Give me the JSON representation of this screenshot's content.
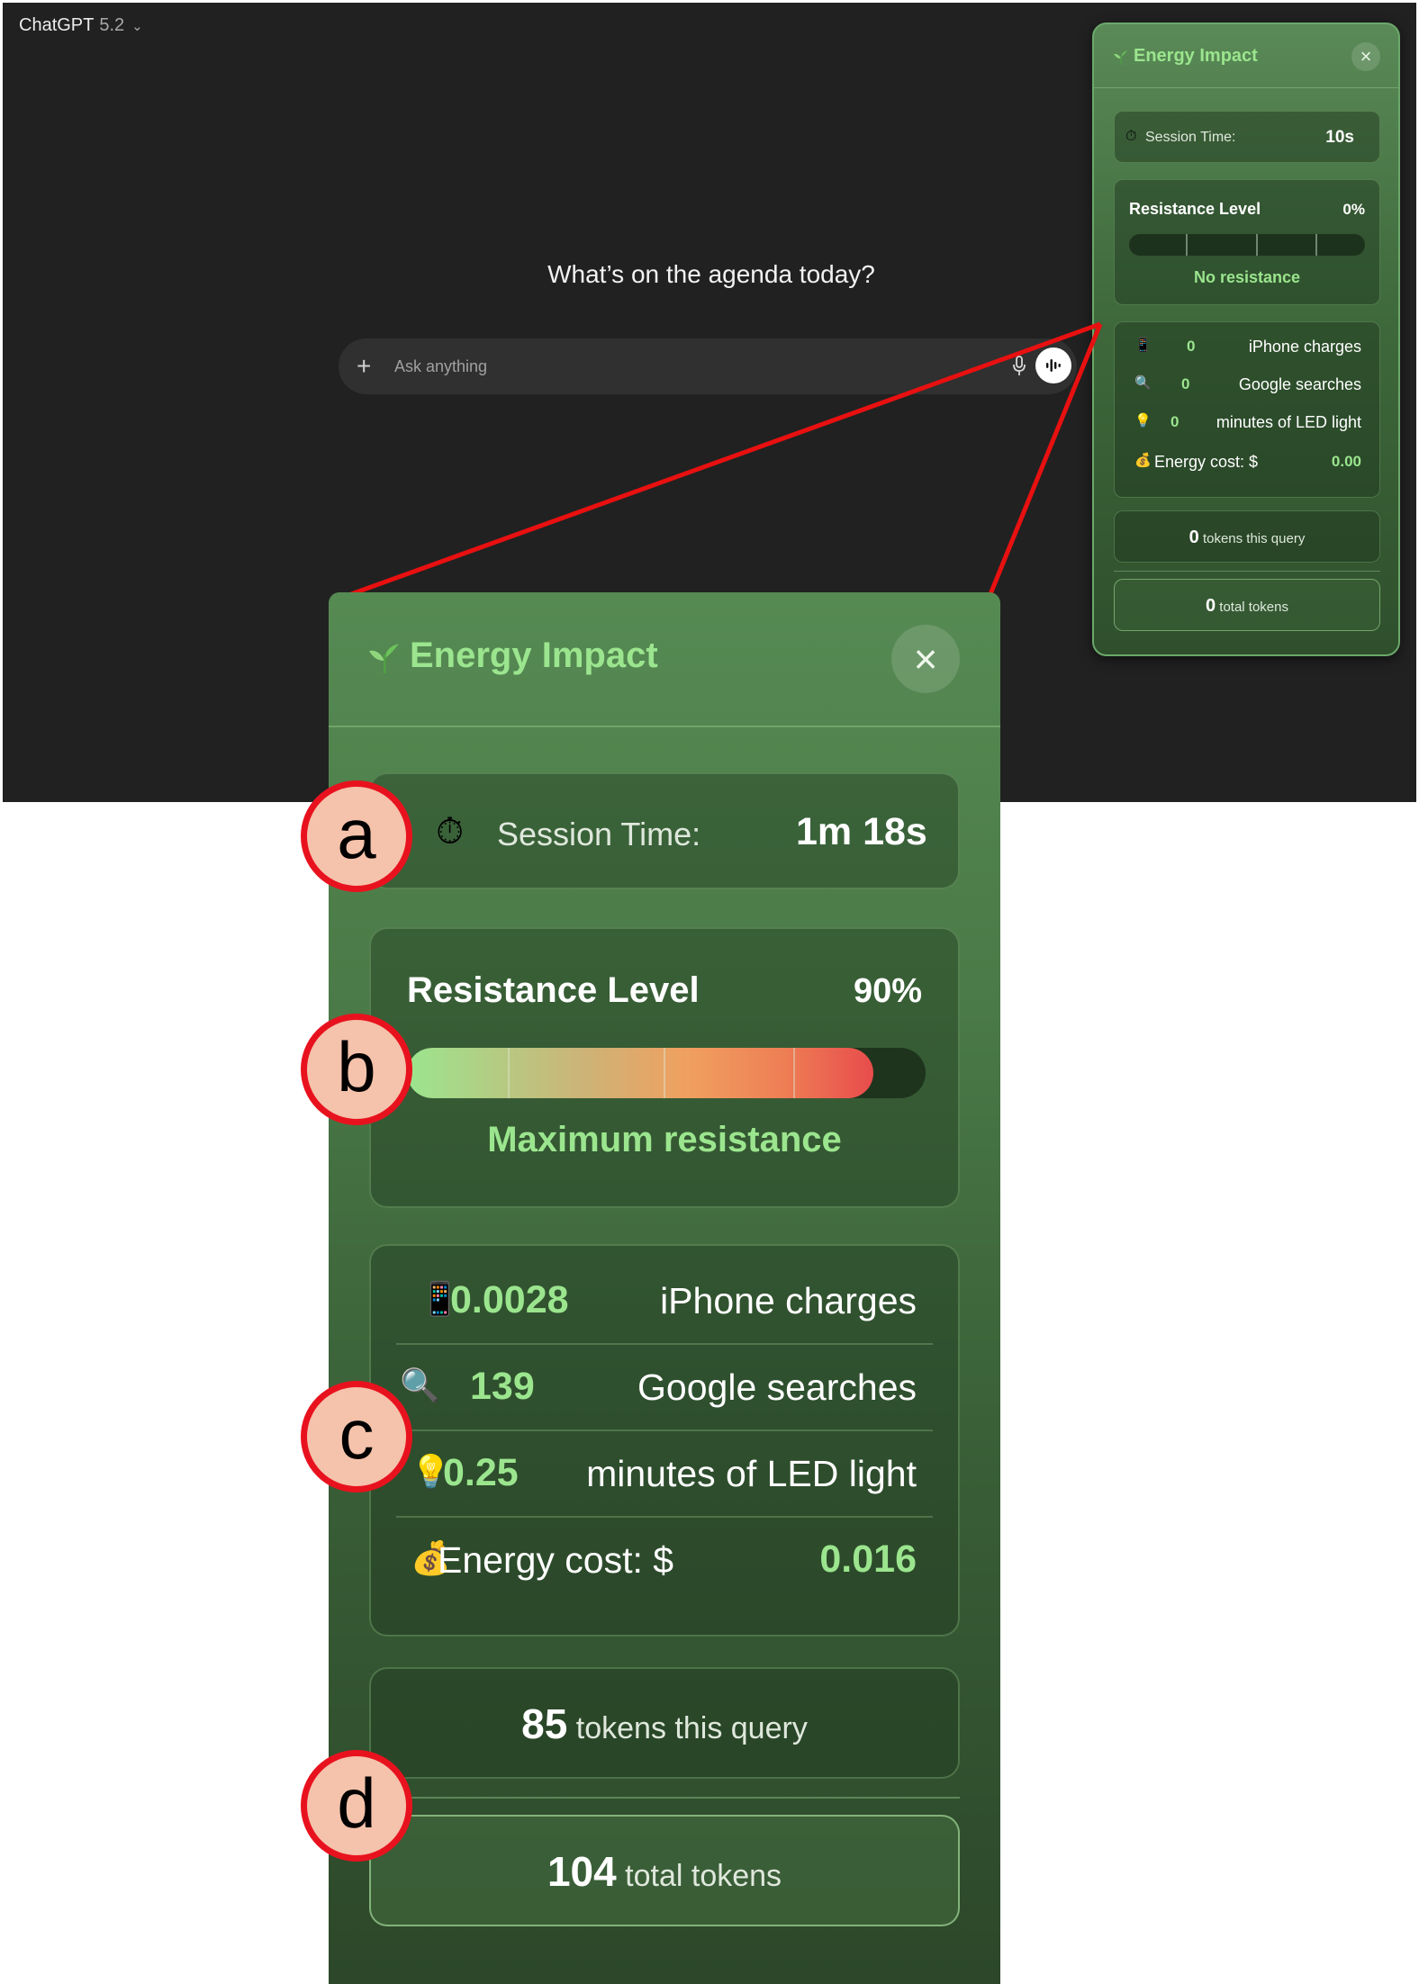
{
  "app": {
    "model_name": "ChatGPT",
    "model_version": "5.2",
    "heading": "What’s on the agenda today?",
    "composer_placeholder": "Ask anything"
  },
  "icons": {
    "sprout": "seedling-icon",
    "timer": "stopwatch-icon",
    "phone": "mobile-phone-icon",
    "search": "magnifying-glass-icon",
    "light": "light-bulb-icon",
    "money": "money-bag-icon",
    "close": "close-icon",
    "plus": "plus-icon",
    "mic": "microphone-icon",
    "voice": "voice-waveform-icon"
  },
  "colors": {
    "accent_green": "#9be58e",
    "panel_green": "#4a7a47",
    "callout_red": "#e8121e",
    "callout_fill": "#f5c2ab",
    "app_bg": "#212121"
  },
  "mini_panel": {
    "title": "Energy Impact",
    "session_label": "Session Time:",
    "session_value": "10s",
    "resistance_label": "Resistance Level",
    "resistance_percent": "0%",
    "resistance_level": 0,
    "resistance_status": "No resistance",
    "stats": [
      {
        "icon": "mobile-phone-icon",
        "value": "0",
        "label": "iPhone charges"
      },
      {
        "icon": "magnifying-glass-icon",
        "value": "0",
        "label": "Google searches"
      },
      {
        "icon": "light-bulb-icon",
        "value": "0",
        "label": "minutes of LED light"
      },
      {
        "icon": "money-bag-icon",
        "label": "Energy cost: $",
        "value": "0.00"
      }
    ],
    "query_tokens_value": "0",
    "query_tokens_label": "tokens this query",
    "total_tokens_value": "0",
    "total_tokens_label": "total tokens"
  },
  "zoom_panel": {
    "title": "Energy Impact",
    "session_label": "Session Time:",
    "session_value": "1m 18s",
    "resistance_label": "Resistance Level",
    "resistance_percent": "90%",
    "resistance_level": 0.9,
    "resistance_status": "Maximum resistance",
    "stats": [
      {
        "icon": "mobile-phone-icon",
        "value": "0.0028",
        "label": "iPhone charges"
      },
      {
        "icon": "magnifying-glass-icon",
        "value": "139",
        "label": "Google searches"
      },
      {
        "icon": "light-bulb-icon",
        "value": "0.25",
        "label": "minutes of LED light"
      },
      {
        "icon": "money-bag-icon",
        "label": "Energy cost: $",
        "value": "0.016"
      }
    ],
    "query_tokens_value": "85",
    "query_tokens_label": "tokens this query",
    "total_tokens_value": "104",
    "total_tokens_label": "total tokens"
  },
  "callouts": [
    "a",
    "b",
    "c",
    "d"
  ]
}
